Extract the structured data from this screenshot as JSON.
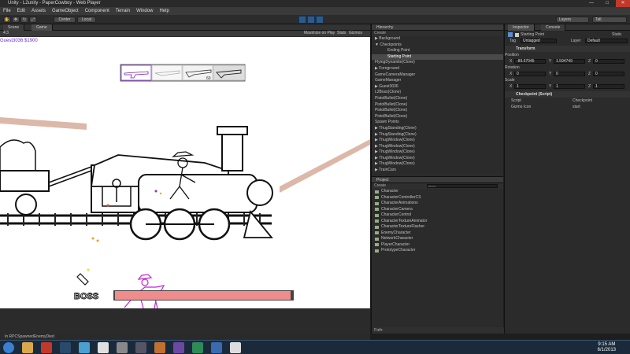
{
  "window": {
    "title": "Unity - L2unity - PaperCowboy - Web Player"
  },
  "menu": [
    "File",
    "Edit",
    "Assets",
    "GameObject",
    "Component",
    "Terrain",
    "Window",
    "Help"
  ],
  "toolbar": {
    "pivot": "Center",
    "space": "Local",
    "layers": "Layers",
    "layout": "Tall"
  },
  "tabs": {
    "scene": "Scene",
    "game": "Game"
  },
  "gamebar": {
    "aspect": "4:3",
    "maximize": "Maximize on Play",
    "stats": "Stats",
    "gizmos": "Gizmos"
  },
  "game": {
    "player_label": "Guest3036",
    "money": "$1900",
    "boss_label": "BOSS",
    "boss_health": 0.98,
    "weapon_ammo": [
      "60"
    ]
  },
  "hierarchy": {
    "title": "Hierarchy",
    "create": "Create",
    "items": [
      {
        "label": "▶ Background",
        "indent": 0,
        "selected": false
      },
      {
        "label": "▼ Checkpoints",
        "indent": 0,
        "selected": false
      },
      {
        "label": "Ending Point",
        "indent": 2,
        "selected": false
      },
      {
        "label": "Starting Point",
        "indent": 2,
        "selected": true
      },
      {
        "label": "FlyingDynamite(Clone)",
        "indent": 0,
        "selected": false
      },
      {
        "label": "▶ Foreground",
        "indent": 0,
        "selected": false
      },
      {
        "label": "GameCameraManager",
        "indent": 0,
        "selected": false
      },
      {
        "label": "GameManager",
        "indent": 0,
        "selected": false
      },
      {
        "label": "▶ Guest3036",
        "indent": 0,
        "selected": false
      },
      {
        "label": "L2Boss(Clone)",
        "indent": 0,
        "selected": false
      },
      {
        "label": "PistolBullet(Clone)",
        "indent": 0,
        "selected": false
      },
      {
        "label": "PistolBullet(Clone)",
        "indent": 0,
        "selected": false
      },
      {
        "label": "PistolBullet(Clone)",
        "indent": 0,
        "selected": false
      },
      {
        "label": "PistolBullet(Clone)",
        "indent": 0,
        "selected": false
      },
      {
        "label": "Spawn Points",
        "indent": 0,
        "selected": false
      },
      {
        "label": "▶ ThugStanding(Clone)",
        "indent": 0,
        "selected": false
      },
      {
        "label": "▶ ThugStanding(Clone)",
        "indent": 0,
        "selected": false
      },
      {
        "label": "▶ ThugWindow(Clone)",
        "indent": 0,
        "selected": false
      },
      {
        "label": "▶ ThugWindow(Clone)",
        "indent": 0,
        "selected": false
      },
      {
        "label": "▶ ThugWindow(Clone)",
        "indent": 0,
        "selected": false
      },
      {
        "label": "▶ ThugWindow(Clone)",
        "indent": 0,
        "selected": false
      },
      {
        "label": "▶ ThugWindow(Clone)",
        "indent": 0,
        "selected": false
      },
      {
        "label": "▶ TrainCars",
        "indent": 0,
        "selected": false
      }
    ]
  },
  "project": {
    "title": "Project",
    "create": "Create",
    "search_placeholder": "chara",
    "items": [
      "Character",
      "CharacterControllerCS",
      "CharacterAnimations",
      "CharacterCamera",
      "CharacterControl",
      "CharacterTextureAnimator",
      "CharacterTextureFlasher",
      "EnemyCharacter",
      "NetworkCharacter",
      "PlayerCharacter",
      "PrototypeCharacter"
    ],
    "path_label": "Path:"
  },
  "inspector": {
    "tabs": [
      "Inspector",
      "Console"
    ],
    "object_name": "Starting Point",
    "static_label": "Static",
    "tag_label": "Tag",
    "tag_value": "Untagged",
    "layer_label": "Layer",
    "layer_value": "Default",
    "transform_title": "Transform",
    "position_label": "Position",
    "position": {
      "x": "-89.67045",
      "y": "1.594749",
      "z": "0"
    },
    "rotation_label": "Rotation",
    "rotation": {
      "x": "0",
      "y": "0",
      "z": "0"
    },
    "scale_label": "Scale",
    "scale": {
      "x": "1",
      "y": "1",
      "z": "1"
    },
    "checkpoint_title": "Checkpoint (Script)",
    "script_label": "Script",
    "script_value": "Checkpoint",
    "gizmo_label": "Gizmo Icon",
    "gizmo_value": "start"
  },
  "status": {
    "text": "In RPCSpawnedEnemyDied"
  },
  "clock": {
    "time": "9:15 AM",
    "date": "6/1/2013"
  },
  "colors": {
    "panel": "#2b2b2b",
    "boss_bar": "#f08c8c",
    "rope": "#d8b0a0",
    "selection": "#4a4a4a"
  },
  "taskbar_icons": [
    "start-orb-icon",
    "explorer-icon",
    "media-icon",
    "steam-icon",
    "chat-icon",
    "browser-icon",
    "unity-icon",
    "tools-icon",
    "game-icon",
    "app-icon",
    "chrome-icon",
    "other-icon",
    "notes-icon"
  ]
}
